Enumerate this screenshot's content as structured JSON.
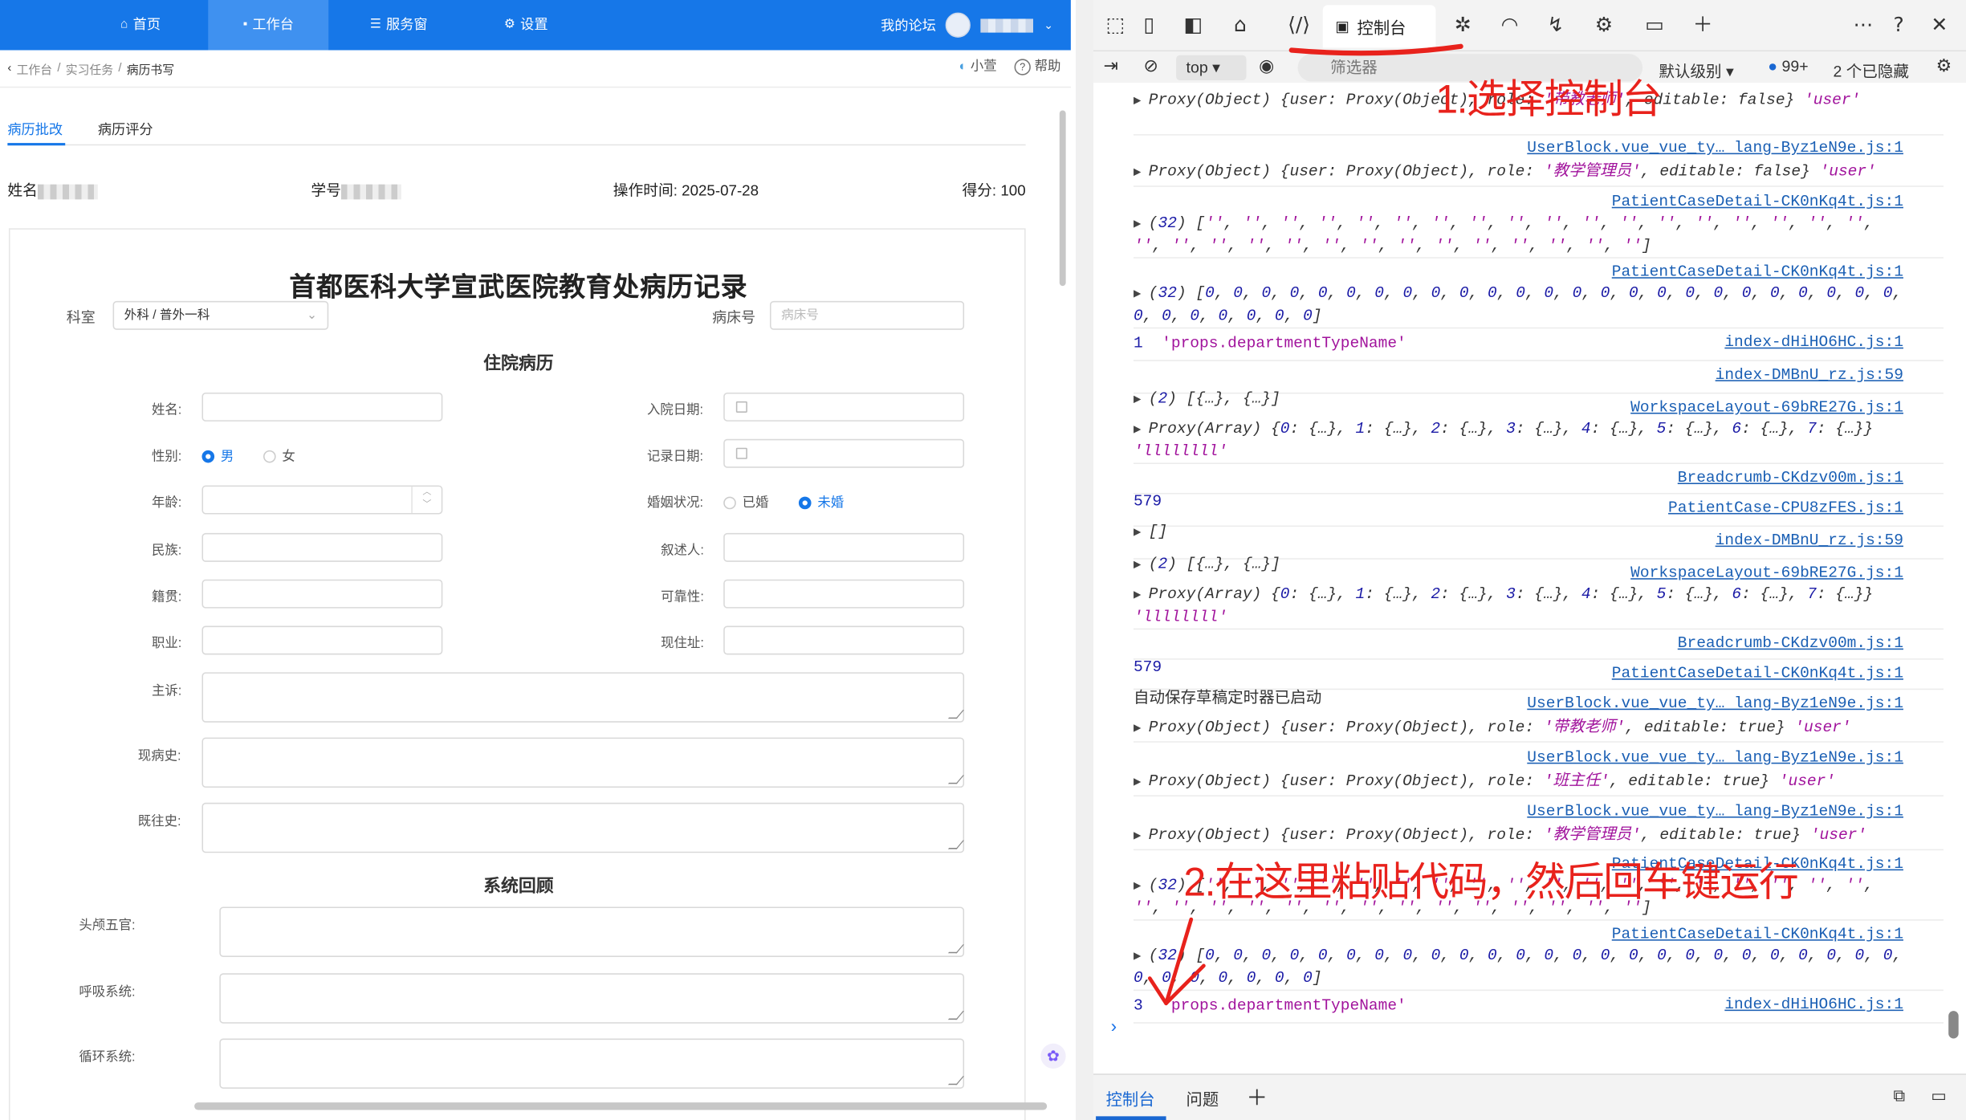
{
  "app": {
    "nav": {
      "home": "首页",
      "workbench": "工作台",
      "service": "服务窗",
      "settings": "设置",
      "forum": "我的论坛"
    },
    "breadcrumb": [
      "工作台",
      "实习任务",
      "病历书写"
    ],
    "breadcrumb_sep": "/",
    "help": {
      "assistant": "小萱",
      "help": "帮助"
    },
    "tabs": [
      "病历批改",
      "病历评分"
    ],
    "info": {
      "name_label": "姓名",
      "id_label": "学号",
      "op_time": "操作时间: 2025-07-28",
      "score": "得分: 100"
    },
    "doc": {
      "title": "首都医科大学宣武医院教育处病历记录",
      "dept_label": "科室",
      "dept_value": "外科 / 普外一科",
      "bed_label": "病床号",
      "bed_placeholder": "病床号",
      "section_inpatient": "住院病历",
      "section_review": "系统回顾",
      "fields": {
        "name": "姓名:",
        "gender": "性别:",
        "male": "男",
        "female": "女",
        "age": "年龄:",
        "ethnicity": "民族:",
        "origin": "籍贯:",
        "job": "职业:",
        "admit_date": "入院日期:",
        "record_date": "记录日期:",
        "marital": "婚姻状况:",
        "married": "已婚",
        "unmarried": "未婚",
        "narrator": "叙述人:",
        "reliability": "可靠性:",
        "address": "现住址:",
        "complaint": "主诉:",
        "present": "现病史:",
        "past": "既往史:",
        "head": "头颅五官:",
        "resp": "呼吸系统:",
        "circ": "循环系统:"
      }
    }
  },
  "devtools": {
    "console_tab": "控制台",
    "context": "top",
    "filter_placeholder": "筛选器",
    "level": "默认级别",
    "issues_count": "99+",
    "hidden": "2 个已隐藏",
    "bottom_tabs": [
      "控制台",
      "问题"
    ],
    "logs": [
      {
        "src": "",
        "text": "Proxy(Object) {user: Proxy(Object), role: '带教老师', editable: false} 'user'"
      },
      {
        "src": "UserBlock.vue_vue_ty… lang-Byz1eN9e.js:1",
        "text": "Proxy(Object) {user: Proxy(Object), role: '教学管理员', editable: false} 'user'"
      },
      {
        "src": "PatientCaseDetail-CK0nKq4t.js:1",
        "text": "(32) ['', '', '', '', '', '', '', '', '', '', '', '', '', '', '', '', '', '', '', '', '', '', '', '', '', '', '', '', '', '', '', '']"
      },
      {
        "src": "PatientCaseDetail-CK0nKq4t.js:1",
        "text": "(32) [0, 0, 0, 0, 0, 0, 0, 0, 0, 0, 0, 0, 0, 0, 0, 0, 0, 0, 0, 0, 0, 0, 0, 0, 0, 0, 0, 0, 0, 0, 0, 0]"
      },
      {
        "src": "index-dHiHO6HC.js:1",
        "count": "1",
        "text": "'props.departmentTypeName'"
      },
      {
        "src": "index-DMBnU_rz.js:59",
        "text": "(2) [{…}, {…}]"
      },
      {
        "src": "WorkspaceLayout-69bRE27G.js:1",
        "text": "Proxy(Array) {0: {…}, 1: {…}, 2: {…}, 3: {…}, 4: {…}, 5: {…}, 6: {…}, 7: {…}} 'llllllll'"
      },
      {
        "src": "Breadcrumb-CKdzv00m.js:1",
        "text": "579"
      },
      {
        "src": "PatientCase-CPU8zFES.js:1",
        "text": "[]"
      },
      {
        "src": "index-DMBnU_rz.js:59",
        "text": "(2) [{…}, {…}]"
      },
      {
        "src": "WorkspaceLayout-69bRE27G.js:1",
        "text": "Proxy(Array) {0: {…}, 1: {…}, 2: {…}, 3: {…}, 4: {…}, 5: {…}, 6: {…}, 7: {…}} 'llllllll'"
      },
      {
        "src": "Breadcrumb-CKdzv00m.js:1",
        "text": "579"
      },
      {
        "src": "PatientCaseDetail-CK0nKq4t.js:1",
        "text": "自动保存草稿定时器已启动"
      },
      {
        "src": "UserBlock.vue_vue_ty… lang-Byz1eN9e.js:1",
        "text": "Proxy(Object) {user: Proxy(Object), role: '带教老师', editable: true} 'user'"
      },
      {
        "src": "UserBlock.vue_vue_ty… lang-Byz1eN9e.js:1",
        "text": "Proxy(Object) {user: Proxy(Object), role: '班主任', editable: true} 'user'"
      },
      {
        "src": "UserBlock.vue_vue_ty… lang-Byz1eN9e.js:1",
        "text": "Proxy(Object) {user: Proxy(Object), role: '教学管理员', editable: true} 'user'"
      },
      {
        "src": "PatientCaseDetail-CK0nKq4t.js:1",
        "text": "(32) ['', '', '', '', '', '', '', '', '', '', '', '', '', '', '', '', '', '', '', '', '', '', '', '', '', '', '', '', '', '', '', '']"
      },
      {
        "src": "PatientCaseDetail-CK0nKq4t.js:1",
        "text": "(32) [0, 0, 0, 0, 0, 0, 0, 0, 0, 0, 0, 0, 0, 0, 0, 0, 0, 0, 0, 0, 0, 0, 0, 0, 0, 0, 0, 0, 0, 0, 0, 0]"
      },
      {
        "src": "index-dHiHO6HC.js:1",
        "count": "3",
        "text": "'props.departmentTypeName'"
      }
    ]
  },
  "annotations": {
    "step1": "1.选择控制台",
    "step2": "2.在这里粘贴代码，然后回车键运行"
  },
  "colors": {
    "brand": "#1677e8",
    "annotation": "#e8221c",
    "link": "#1a5fb4"
  }
}
